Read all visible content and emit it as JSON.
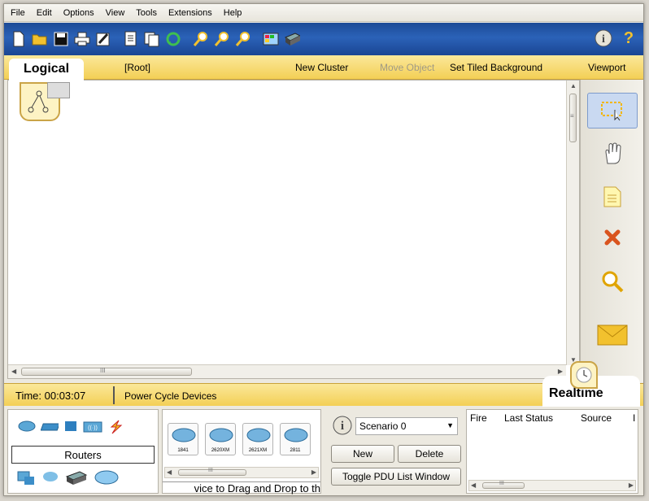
{
  "menu": [
    "File",
    "Edit",
    "Options",
    "View",
    "Tools",
    "Extensions",
    "Help"
  ],
  "toolbar": {
    "icons": [
      "new-icon",
      "open-icon",
      "save-icon",
      "print-icon",
      "activity-wizard-icon",
      "copy-icon",
      "paste-icon",
      "undo-icon",
      "zoom-in-icon",
      "zoom-reset-icon",
      "zoom-out-icon",
      "palette-icon",
      "custom-device-icon"
    ],
    "right_icons": [
      "info-icon",
      "help-icon"
    ],
    "help_label": "?"
  },
  "logical_bar": {
    "tab_label": "Logical",
    "root": "[Root]",
    "new_cluster": "New Cluster",
    "move_object": "Move Object",
    "tiled_bg": "Set Tiled Background",
    "viewport": "Viewport"
  },
  "workspace": {
    "h_thumb_mark": "III",
    "v_thumb_mark": "≡"
  },
  "right_tools": [
    "select-icon",
    "move-layout-icon",
    "note-icon",
    "delete-icon",
    "inspect-icon",
    "simple-pdu-icon"
  ],
  "status_bar": {
    "time_label": "Time: 00:03:07",
    "power_cycle": "Power Cycle Devices",
    "realtime_label": "Realtime"
  },
  "device_panel": {
    "category_label": "Routers",
    "devices": [
      "1841",
      "2620XM",
      "2621XM",
      "2811"
    ],
    "hint": "vice to Drag and Drop to th",
    "scroll_mark": "III"
  },
  "scenario": {
    "info_glyph": "i",
    "selected": "Scenario 0",
    "new_label": "New",
    "delete_label": "Delete",
    "toggle_label": "Toggle PDU List Window"
  },
  "pdu_list": {
    "headers": [
      "Fire",
      "Last Status",
      "Source",
      "I"
    ],
    "scroll_mark": "III"
  },
  "colors": {
    "toolbar_blue": "#2b62b8",
    "accent_yellow": "#f3cf55",
    "delete_red": "#d9541e"
  }
}
